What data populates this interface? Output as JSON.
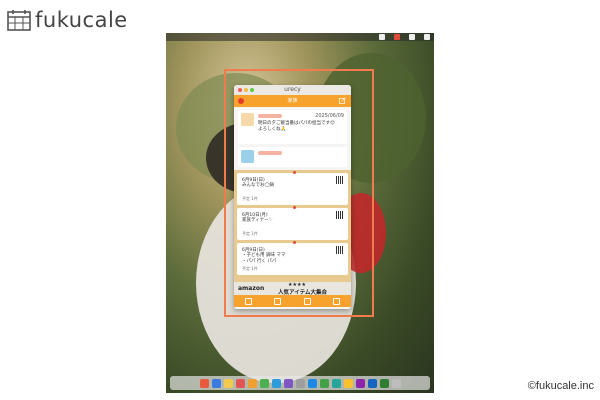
{
  "brand": {
    "name": "fukucale",
    "logo_icon": "calendar-icon"
  },
  "copyright": "©fukucale.inc",
  "app": {
    "window_title": "urecy",
    "header_title": "家族",
    "messages": [
      {
        "date": "2025/06/09",
        "body_line1": "明日の夕ご飯当番はパパの担当です😊",
        "body_line2": "よろしくね🙏"
      }
    ],
    "cards": [
      {
        "date": "6月9日(日)",
        "text": "みんなでお◯鍋",
        "badge": "予定 1件"
      },
      {
        "date": "6月10日(月)",
        "text": "家族ディナー♡",
        "badge": "予定 1件"
      },
      {
        "date": "6月9日(日)",
        "text_line1": "・子ども用 調味 ママ",
        "text_line2": "・パパ 行く パパ",
        "badge": "予定 1件"
      }
    ],
    "ad": {
      "brand": "amazon",
      "stars": "★★★★",
      "text": "人気アイテム大集合"
    }
  },
  "colors": {
    "accent": "#f7a22c",
    "highlight": "#f07c4e",
    "card_bg": "#e8c98f"
  },
  "dock_icons": [
    "finder-icon",
    "mail-icon",
    "notes-icon",
    "calendar-icon",
    "music-icon",
    "photos-icon",
    "maps-icon",
    "appstore-icon",
    "settings-icon",
    "safari-icon",
    "messages-icon",
    "facetime-icon",
    "chrome-icon",
    "slack-icon",
    "word-icon",
    "excel-icon",
    "trash-icon"
  ]
}
